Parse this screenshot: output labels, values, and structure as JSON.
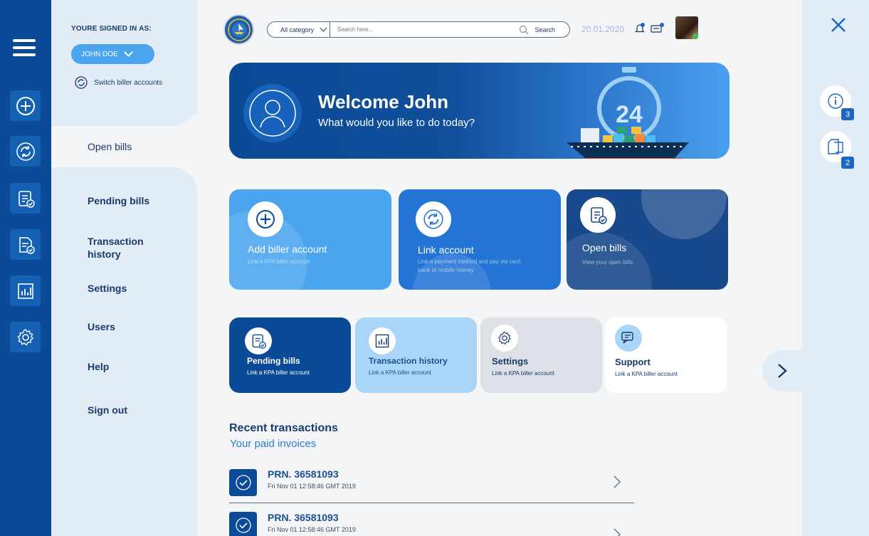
{
  "sidebar": {
    "signed_in_label": "YOURE SIGNED IN AS:",
    "user_name": "JOHN DOE",
    "switch_label": "Switch biller accounts",
    "items": [
      {
        "label": "Open bills"
      },
      {
        "label": "Pending bills"
      },
      {
        "label": "Transaction history"
      },
      {
        "label": "Settings"
      },
      {
        "label": "Users"
      },
      {
        "label": "Help"
      },
      {
        "label": "Sign out"
      }
    ]
  },
  "header": {
    "category": "All category",
    "search_placeholder": "Search here...",
    "search_label": "Search",
    "date": "20.01.2020",
    "notification_count": "1",
    "message_count": "1"
  },
  "banner": {
    "title": "Welcome John",
    "subtitle": "What would you like to do today?",
    "badge": "24"
  },
  "action_cards": [
    {
      "title": "Add biller account",
      "subtitle": "Link a KPA biller account",
      "color": "#4aa4ee"
    },
    {
      "title": "Link account",
      "subtitle": "Link a payment method and pay via card, bank or mobile money",
      "color": "#2474d6"
    },
    {
      "title": "Open bills",
      "subtitle": "View your open bills",
      "color": "#18498c"
    }
  ],
  "quick_cards": [
    {
      "title": "Pending bills",
      "subtitle": "Link a KPA biller account"
    },
    {
      "title": "Transaction history",
      "subtitle": "Link a KPA biller account"
    },
    {
      "title": "Settings",
      "subtitle": "Link a KPA biller account"
    },
    {
      "title": "Support",
      "subtitle": "Link a KPA biller account"
    }
  ],
  "recent": {
    "title": "Recent transactions",
    "subtitle": "Your paid invoices",
    "items": [
      {
        "prn": "PRN. 36581093",
        "date": "Fri Nov 01 12:58:46 GMT 2019"
      },
      {
        "prn": "PRN. 36581093",
        "date": "Fri Nov 01 12:58:46 GMT 2019"
      }
    ]
  },
  "right_panel": {
    "info_count": "3",
    "docs_count": "2"
  },
  "colors": {
    "navy": "#0a4a96",
    "light_blue": "#4aa4ee",
    "panel": "#e2ecf7"
  }
}
